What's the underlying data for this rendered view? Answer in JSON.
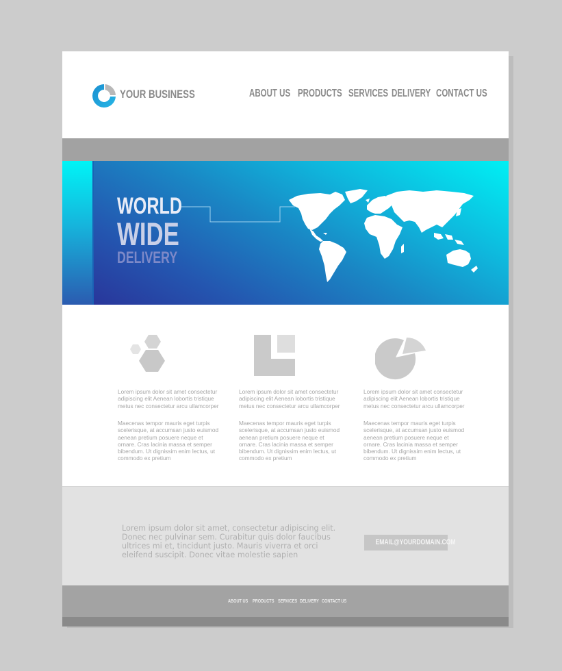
{
  "header": {
    "brand": "YOUR BUSINESS",
    "logo_icon": "donut-chart-logo-icon",
    "nav": [
      "ABOUT US",
      "PRODUCTS",
      "SERVICES",
      "DELIVERY",
      "CONTACT US"
    ]
  },
  "hero": {
    "line1": "WORLD",
    "line2": "WIDE",
    "line3": "DELIVERY",
    "image": "world-map-icon"
  },
  "features": [
    {
      "icon": "hexagons-icon",
      "p1": "Lorem ipsum dolor sit amet consectetur adipiscing elit Aenean lobortis tristique metus nec consectetur arcu ullamcorper",
      "p2": "Maecenas tempor mauris eget turpis scelerisque, at accumsan justo euismod aenean pretium posuere neque et ornare. Cras lacinia massa et semper bibendum. Ut dignissim enim lectus, ut commodo ex pretium"
    },
    {
      "icon": "squares-layout-icon",
      "p1": "Lorem ipsum dolor sit amet consectetur adipiscing elit Aenean lobortis tristique metus nec consectetur arcu ullamcorper",
      "p2": "Maecenas tempor mauris eget turpis scelerisque, at accumsan justo euismod aenean pretium posuere neque et ornare. Cras lacinia massa et semper bibendum. Ut dignissim enim lectus, ut commodo ex pretium"
    },
    {
      "icon": "pie-chart-icon",
      "p1": "Lorem ipsum dolor sit amet consectetur adipiscing elit Aenean lobortis tristique metus nec consectetur arcu ullamcorper",
      "p2": "Maecenas tempor mauris eget turpis scelerisque, at accumsan justo euismod aenean pretium posuere neque et ornare. Cras lacinia massa et semper bibendum. Ut dignissim enim lectus, ut commodo ex pretium"
    }
  ],
  "contact": {
    "text": "Lorem ipsum dolor sit amet, consectetur adipiscing elit. Donec nec pulvinar sem. Curabitur quis dolor faucibus ultrices mi et, tincidunt justo. Mauris viverra et orci eleifend suscipit. Donec vitae molestie sapien",
    "email": "EMAIL@YOURDOMAIN.COM"
  },
  "footer": {
    "nav": [
      "ABOUT US",
      "PRODUCTS",
      "SERVICES",
      "DELIVERY",
      "CONTACT US"
    ]
  },
  "colors": {
    "accent_cyan": "#00f0f4",
    "accent_blue": "#2a2f96",
    "text_gray": "#8a8a8a",
    "band_gray": "#a2a2a2"
  }
}
